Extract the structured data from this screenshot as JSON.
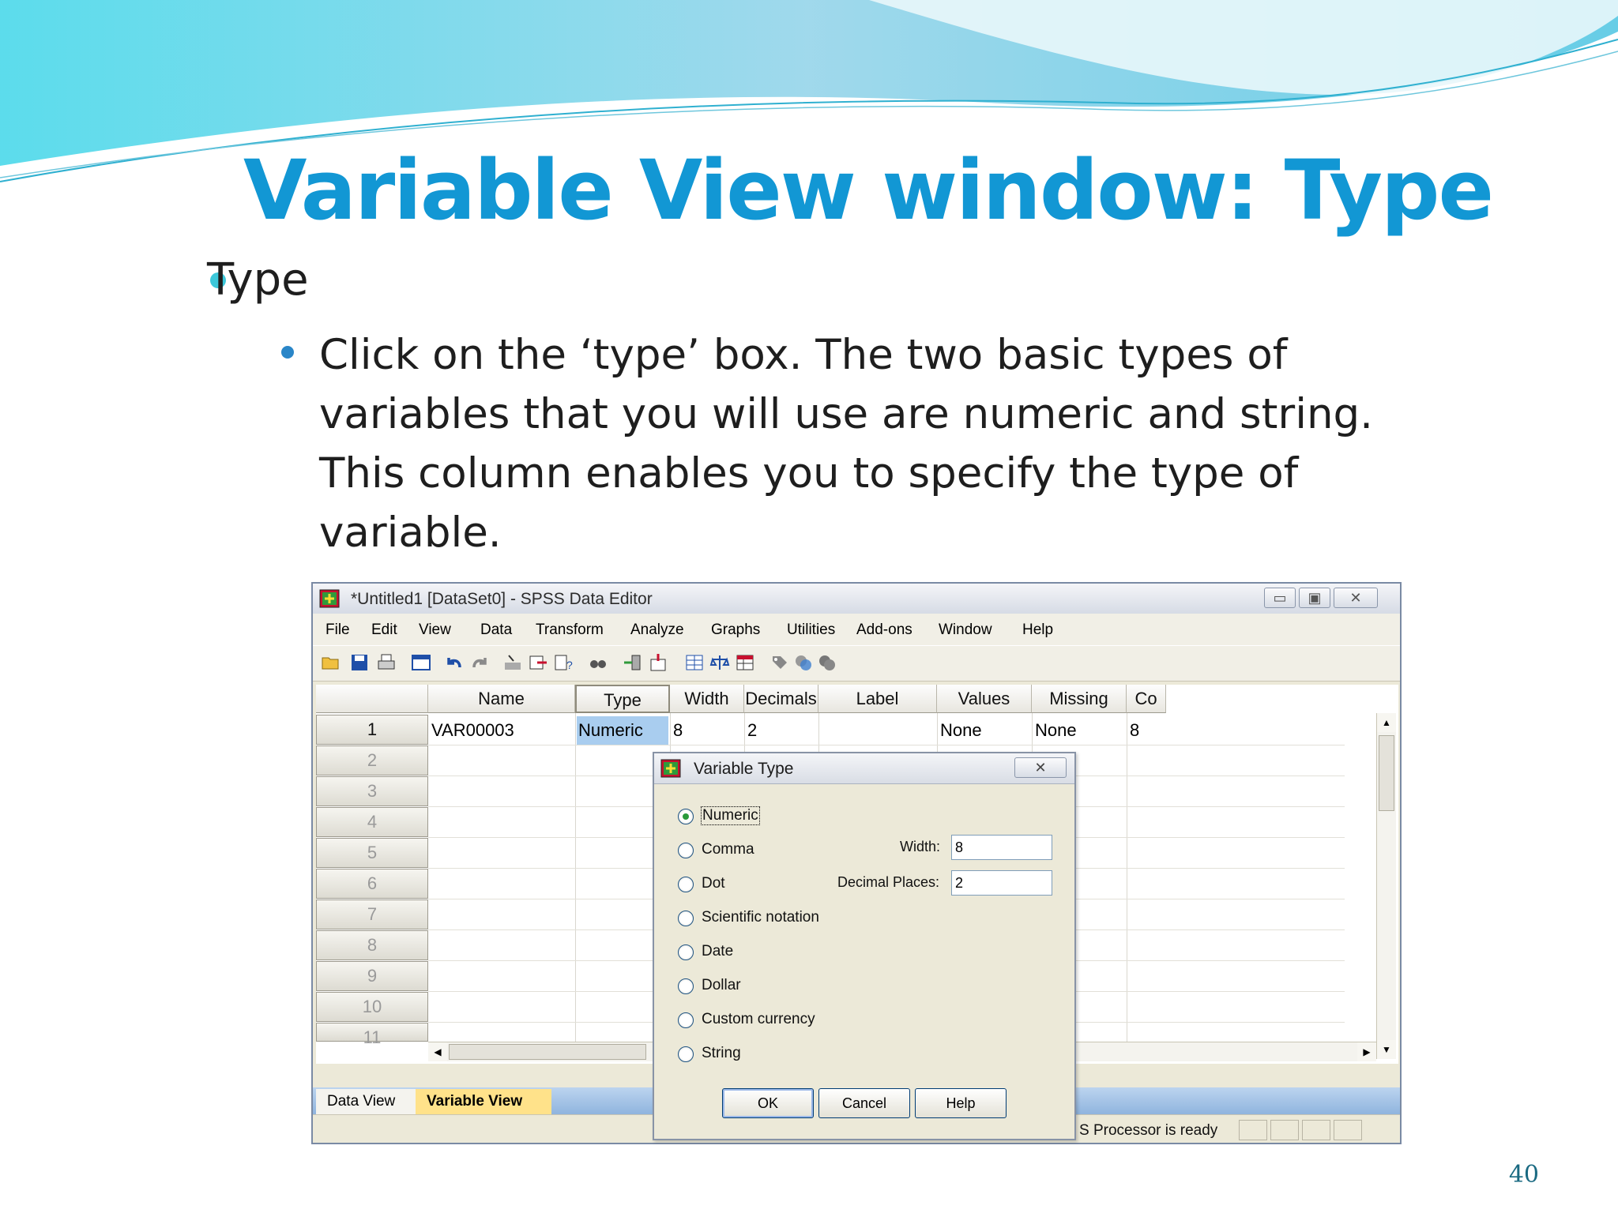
{
  "slide": {
    "title": "Variable View window: Type",
    "bullet1": "Type",
    "bullet2": "Click on the ‘type’ box. The two basic types of variables that you will use are numeric and string. This column enables you to specify the type of variable.",
    "page_number": "40"
  },
  "colors": {
    "title": "#1297d4",
    "wave": "#3cc7d9",
    "selected_cell": "#a9cdef",
    "active_tab": "#ffe28a"
  },
  "window": {
    "title": "*Untitled1 [DataSet0] - SPSS Data Editor",
    "controls": {
      "minimize": "▭",
      "maximize": "▣",
      "close": "✕"
    },
    "menu": [
      "File",
      "Edit",
      "View",
      "Data",
      "Transform",
      "Analyze",
      "Graphs",
      "Utilities",
      "Add-ons",
      "Window",
      "Help"
    ],
    "toolbar_icons": [
      "open-icon",
      "save-icon",
      "print-icon",
      "dialog-recall-icon",
      "undo-icon",
      "redo-icon",
      "goto-case-icon",
      "goto-variable-icon",
      "variables-icon",
      "find-icon",
      "insert-cases-icon",
      "insert-variable-icon",
      "split-file-icon",
      "weight-cases-icon",
      "select-cases-icon",
      "value-labels-icon",
      "use-sets-icon",
      "show-all-icon"
    ],
    "columns": [
      "Name",
      "Type",
      "Width",
      "Decimals",
      "Label",
      "Values",
      "Missing",
      "Co"
    ],
    "rows": [
      "1",
      "2",
      "3",
      "4",
      "5",
      "6",
      "7",
      "8",
      "9",
      "10",
      "11"
    ],
    "row1": {
      "name": "VAR00003",
      "type": "Numeric",
      "width": "8",
      "decimals": "2",
      "label": "",
      "values": "None",
      "missing": "None",
      "co": "8"
    },
    "tabs": {
      "data_view": "Data View",
      "variable_view": "Variable View"
    },
    "status": "S  Processor is ready"
  },
  "dialog": {
    "title": "Variable Type",
    "close": "✕",
    "options": [
      "Numeric",
      "Comma",
      "Dot",
      "Scientific notation",
      "Date",
      "Dollar",
      "Custom currency",
      "String"
    ],
    "selected": "Numeric",
    "width_label": "Width:",
    "width_value": "8",
    "decimal_label": "Decimal Places:",
    "decimal_value": "2",
    "buttons": {
      "ok": "OK",
      "cancel": "Cancel",
      "help": "Help"
    }
  }
}
